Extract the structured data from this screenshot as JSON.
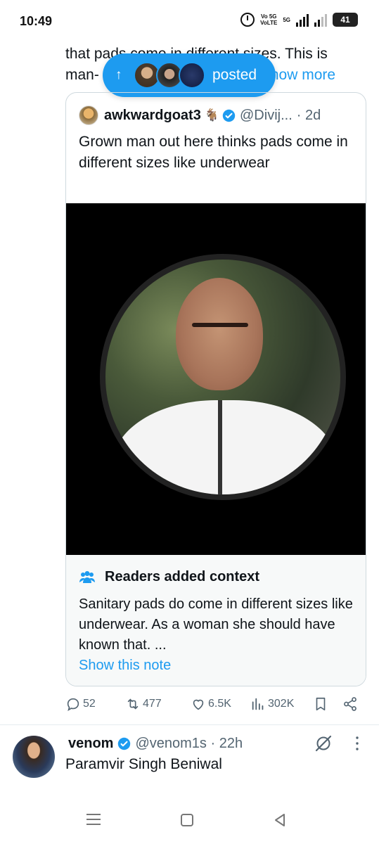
{
  "status_bar": {
    "time": "10:49",
    "network_label_top": "Vo 5G",
    "network_label_bottom": "VoLTE",
    "network_5g": "5G",
    "battery": "41"
  },
  "top_tweet": {
    "text_line1": "that pads come in different sizes. This is",
    "text_line2_prefix": "man-",
    "show_more": "Show more"
  },
  "new_posts_pill": {
    "label": "posted",
    "arrow": "↑"
  },
  "quote": {
    "name": "awkwardgoat3",
    "emoji": "🐐",
    "handle": "@Divij...",
    "time": "· 2d",
    "text": "Grown man out here thinks pads come in different sizes like underwear",
    "context": {
      "title": "Readers added context",
      "body": "Sanitary pads do come in different sizes like underwear. As a woman she should have known that. ...",
      "show_note": "Show this note"
    }
  },
  "actions": {
    "replies": "52",
    "reposts": "477",
    "likes": "6.5K",
    "views": "302K"
  },
  "next_tweet": {
    "name": "venom",
    "handle": "@venom1s · 22h",
    "text": "Paramvir Singh Beniwal"
  },
  "colors": {
    "accent": "#1d9bf0",
    "secondary_text": "#536471",
    "border": "#cfd9de"
  }
}
